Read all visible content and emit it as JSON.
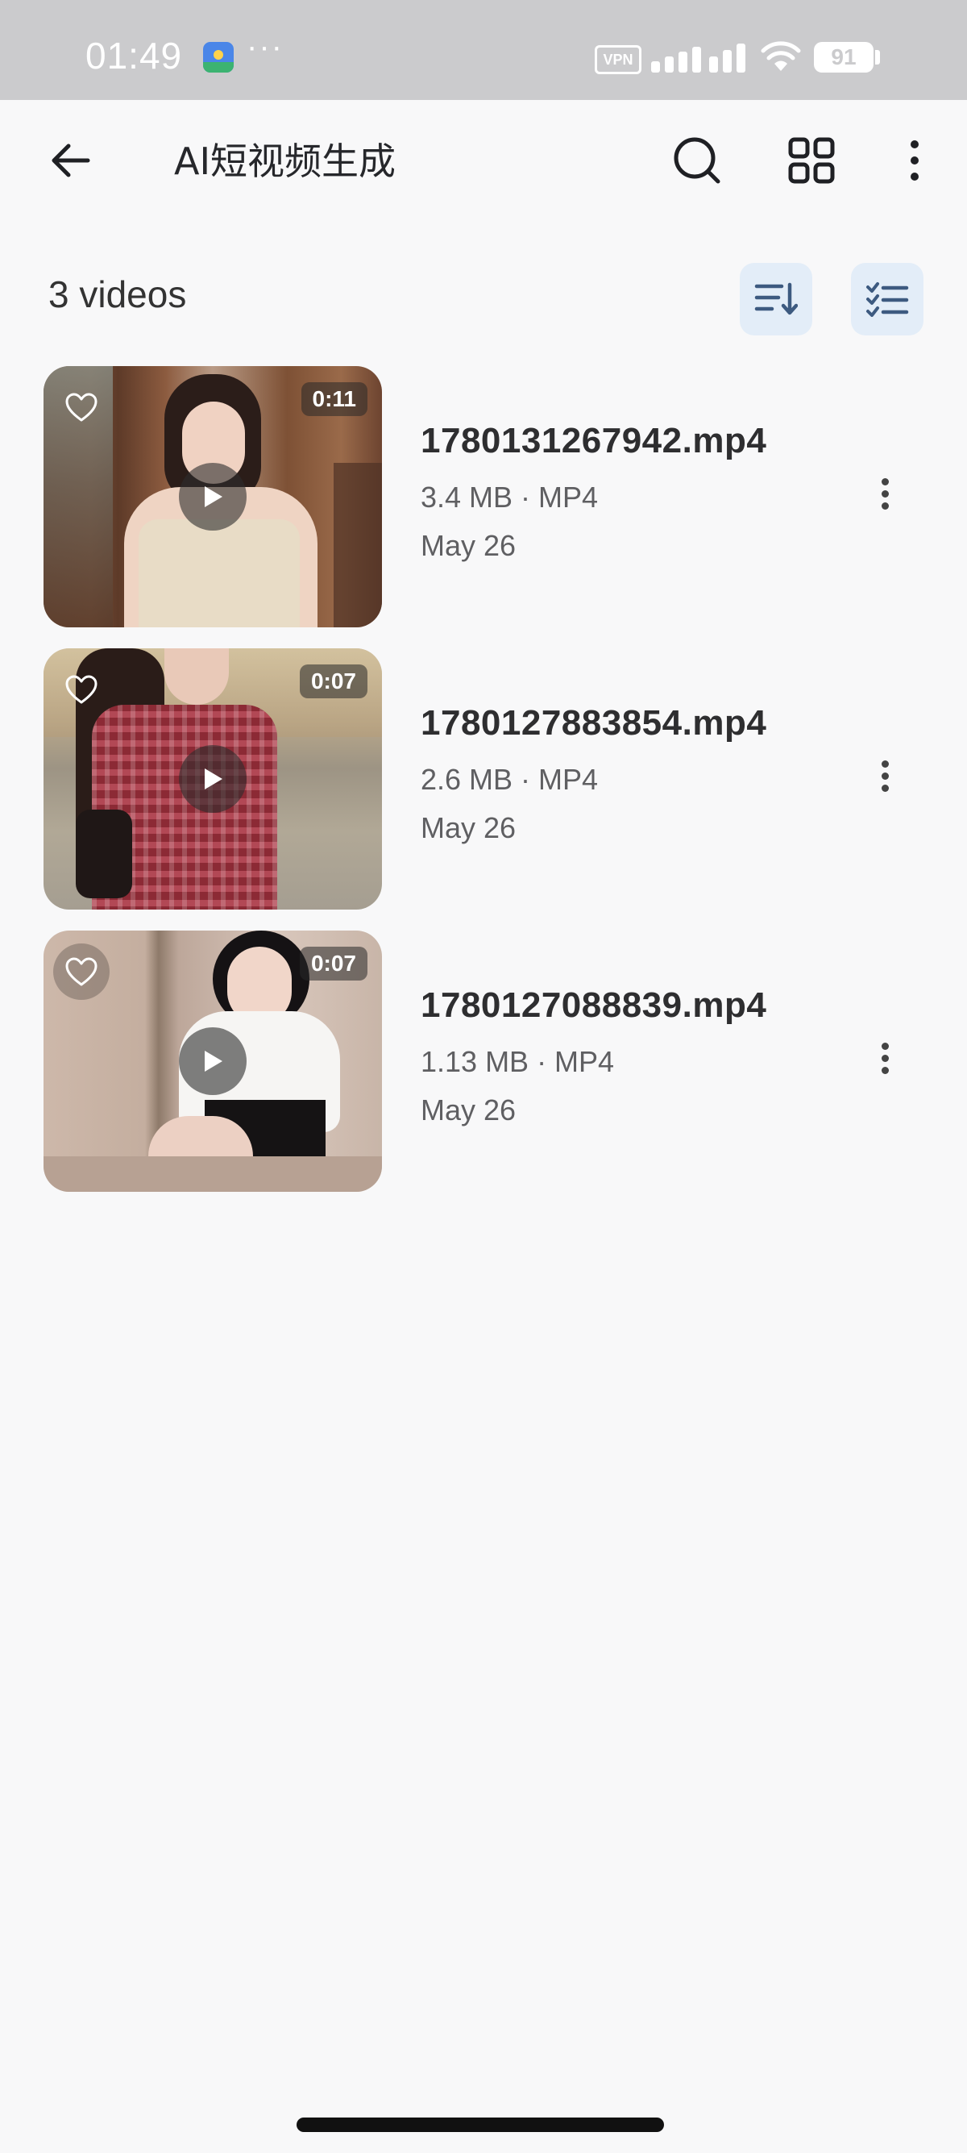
{
  "status_bar": {
    "time": "01:49",
    "dots": "···",
    "vpn": "VPN",
    "battery": "91",
    "icons": [
      "app-icon",
      "signal-icon",
      "wifi-icon",
      "battery-icon"
    ]
  },
  "app_bar": {
    "title": "AI短视频生成",
    "icons": [
      "back-arrow-icon",
      "search-icon",
      "grid-view-icon",
      "more-vertical-icon"
    ]
  },
  "list_header": {
    "count_label": "3 videos",
    "icons": [
      "sort-icon",
      "multi-select-icon"
    ]
  },
  "videos": [
    {
      "filename": "1780131267942.mp4",
      "meta": "3.4 MB · MP4",
      "date": "May 26",
      "duration": "0:11"
    },
    {
      "filename": "1780127883854.mp4",
      "meta": "2.6 MB · MP4",
      "date": "May 26",
      "duration": "0:07"
    },
    {
      "filename": "1780127088839.mp4",
      "meta": "1.13 MB · MP4",
      "date": "May 26",
      "duration": "0:07"
    }
  ],
  "colors": {
    "background": "#f8f8f9",
    "status_bar": "#cbcbcd",
    "pill_button": "#e3edf8",
    "accent_icon": "#3d5a80"
  }
}
